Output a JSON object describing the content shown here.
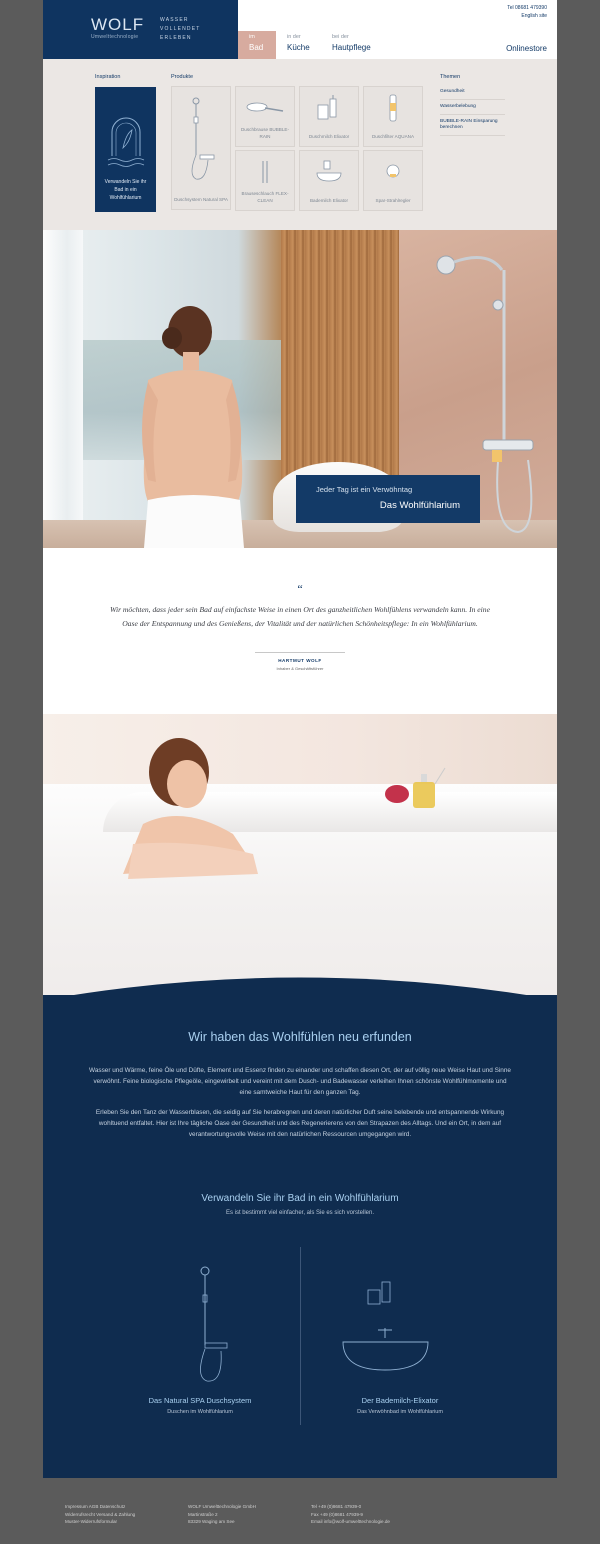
{
  "header": {
    "logo": "WOLF",
    "logo_sub": "Umwelttechnologie",
    "tagline": [
      "WASSER",
      "VOLLENDET",
      "ERLEBEN"
    ],
    "tabs": [
      {
        "pre": "im",
        "main": "Bad"
      },
      {
        "pre": "in der",
        "main": "Küche"
      },
      {
        "pre": "bei der",
        "main": "Hautpflege"
      }
    ],
    "phone": "Tel 08681 479390",
    "english": "English site",
    "onlinestore": "Onlinestore"
  },
  "mega": {
    "inspiration_heading": "Inspiration",
    "inspiration_card": "Verwandeln Sie ihr Bad in ein Wohlfühlarium",
    "products_heading": "Produkte",
    "products": [
      {
        "label": "Duschsystem Natural SPA",
        "icon": "shower-system-icon"
      },
      {
        "label": "Duschbrause BUBBLE-RAIN",
        "icon": "shower-head-icon"
      },
      {
        "label": "Duschmilch Elixator",
        "icon": "shower-milk-icon"
      },
      {
        "label": "Duschfilter AQUANA",
        "icon": "shower-filter-icon"
      },
      {
        "label": "Brauseschlauch FLEX-CLEAN",
        "icon": "shower-hose-icon"
      },
      {
        "label": "Bademilch Elixator",
        "icon": "bath-milk-icon"
      },
      {
        "label": "Spar-Strahlregler",
        "icon": "aerator-icon"
      }
    ],
    "themes_heading": "Themen",
    "themes": [
      "Gesundheit",
      "Wasserbelebung",
      "BUBBLE-RAIN Einsparung berechnen"
    ]
  },
  "hero": {
    "line1": "Jeder Tag ist ein Verwöhntag",
    "line2": "Das Wohlfühlarium"
  },
  "quote": {
    "mark": "“",
    "text": "Wir möchten, dass jeder sein Bad auf einfachste Weise in einen Ort des ganzheitlichen Wohlfühlens verwandeln kann. In eine Oase der Entspannung und des Genießens, der Vitalität und der natürlichen Schönheitspflege: In ein Wohlfühlarium.",
    "name": "HARTMUT WOLF",
    "role": "Inhaber & Geschäftsführer"
  },
  "intro": {
    "title": "Wir haben das Wohlfühlen neu erfunden",
    "p1": "Wasser und Wärme, feine Öle und Düfte, Element und Essenz finden zu einander und schaffen diesen Ort, der auf völlig neue Weise Haut und Sinne verwöhnt. Feine biologische Pflegeöle, eingewirbelt und vereint mit dem Dusch- und Badewasser verleihen Ihnen schönste Wohlfühlmomente und eine samtweiche Haut für den ganzen Tag.",
    "p2": "Erleben Sie den Tanz der Wasserblasen, die seidig auf Sie herabregnen und deren natürlicher Duft seine belebende und entspannende Wirkung wohltuend entfaltet. Hier ist Ihre tägliche Oase der Gesundheit und des Regenerierens von den Strapazen des Alltags. Und ein Ort, in dem auf verantwortungsvolle Weise mit den natürlichen Ressourcen umgegangen wird.",
    "title2": "Verwandeln Sie ihr Bad in ein Wohlfühlarium",
    "sub": "Es ist bestimmt viel einfacher, als Sie es sich vorstellen.",
    "col1_title": "Das Natural SPA Duschsystem",
    "col1_sub": "Duschen im Wohlfühlarium",
    "col2_title": "Der Bademilch-Elixator",
    "col2_sub": "Das Verwöhnbad im Wohlfühlarium"
  },
  "footer": {
    "col1": [
      "Impressum   AGB   Datenschutz",
      "Widerrufsrecht   Versand & Zahlung",
      "Muster-Widerrufsformular"
    ],
    "col2": [
      "WOLF Umwelttechnologie GmbH",
      "Martinstraße 2",
      "83329 Waging am See"
    ],
    "col3": [
      "Tel +49 (0)8681 47939-0",
      "Fax +49 (0)8681 47939-9",
      "Email info@wolf-umwelttechnologie.de"
    ]
  },
  "colors": {
    "navy": "#0f3460",
    "rose": "#d7ab9f",
    "sky": "#a9d0f0"
  }
}
